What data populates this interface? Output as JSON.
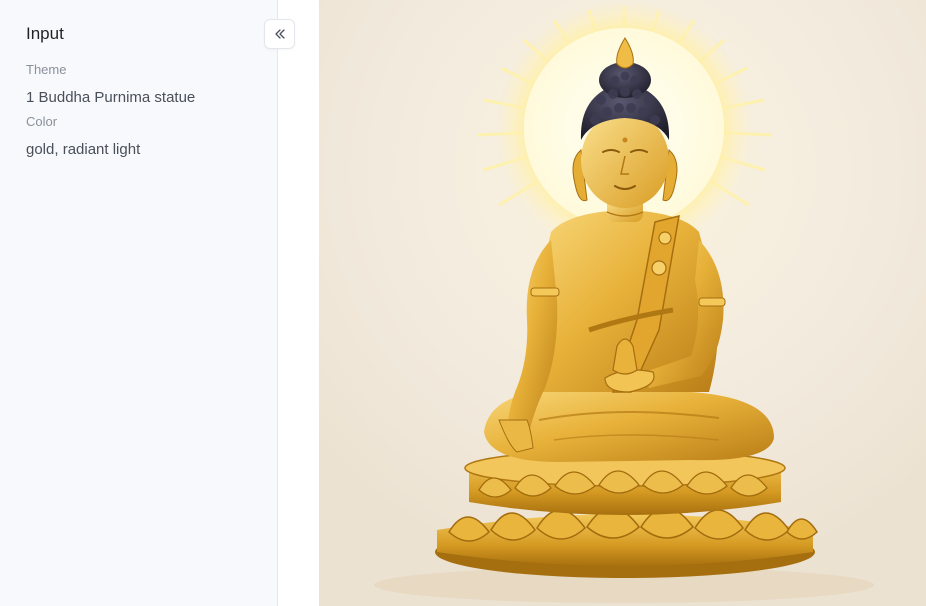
{
  "sidebar": {
    "title": "Input",
    "fields": [
      {
        "label": "Theme",
        "value": "1 Buddha Purnima statue"
      },
      {
        "label": "Color",
        "value": "gold, radiant light"
      }
    ]
  },
  "icons": {
    "collapse": "chevrons-left-icon"
  },
  "image": {
    "subject": "golden-buddha-statue"
  },
  "colors": {
    "gold": "#e0a92a",
    "halo": "#fff6c8",
    "hair": "#2d2b3a"
  }
}
